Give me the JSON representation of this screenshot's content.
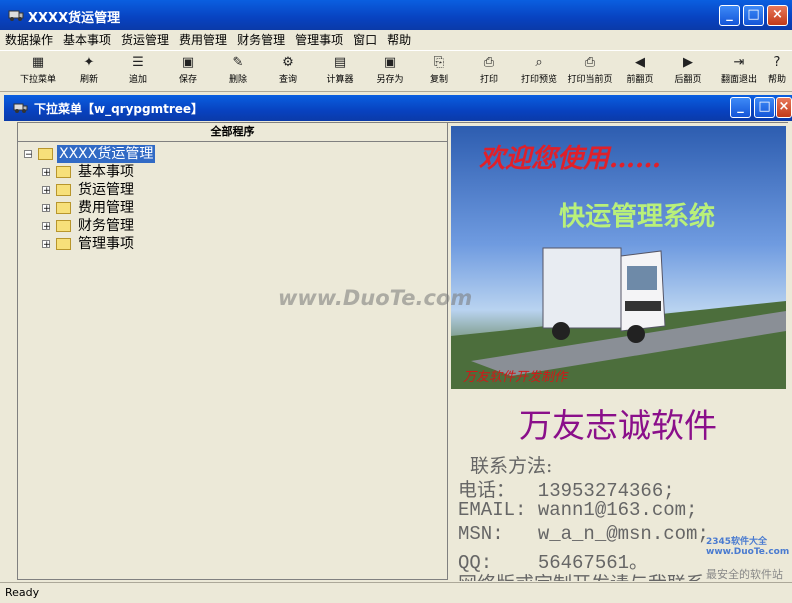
{
  "window": {
    "title": "XXXX货运管理"
  },
  "menu": [
    "数据操作",
    "基本事项",
    "货运管理",
    "费用管理",
    "财务管理",
    "管理事项",
    "窗口",
    "帮助"
  ],
  "toolbar": [
    {
      "label": "下拉菜单",
      "icon": "dropdown-menu-icon"
    },
    {
      "label": "刷新",
      "icon": "refresh-icon"
    },
    {
      "label": "追加",
      "icon": "append-icon"
    },
    {
      "label": "保存",
      "icon": "save-icon"
    },
    {
      "label": "删除",
      "icon": "delete-icon"
    },
    {
      "label": "查询",
      "icon": "query-icon"
    },
    {
      "label": "计算器",
      "icon": "calculator-icon"
    },
    {
      "label": "另存为",
      "icon": "save-as-icon"
    },
    {
      "label": "复制",
      "icon": "copy-icon"
    },
    {
      "label": "打印",
      "icon": "print-icon"
    },
    {
      "label": "打印预览",
      "icon": "print-preview-icon"
    },
    {
      "label": "打印当前页",
      "icon": "print-page-icon"
    },
    {
      "label": "前翻页",
      "icon": "prev-page-icon"
    },
    {
      "label": "后翻页",
      "icon": "next-page-icon"
    },
    {
      "label": "翻面退出",
      "icon": "exit-icon"
    },
    {
      "label": "帮助",
      "icon": "help-icon"
    }
  ],
  "mdi": {
    "title": "下拉菜单【w_qrypgmtree】"
  },
  "tree": {
    "header": "全部程序",
    "root": "XXXX货运管理",
    "children": [
      "基本事项",
      "货运管理",
      "费用管理",
      "财务管理",
      "管理事项"
    ]
  },
  "banner": {
    "welcome": "欢迎您使用……",
    "system_name": "快运管理系统",
    "maker": "万友软件开发制作"
  },
  "company": "万友志诚软件",
  "contact": {
    "heading": "联系方法:",
    "lines": [
      "电话：  13953274366;",
      "EMAIL: wann1@163.com;",
      "MSN:   w_a_n_@msn.com;",
      "QQ:    56467561。",
      "网络版或定制开发请与我联系"
    ]
  },
  "status": "Ready",
  "watermarks": [
    "www.DuoTe.com",
    "2345软件大全 www.DuoTe.com",
    "最安全的软件站"
  ]
}
